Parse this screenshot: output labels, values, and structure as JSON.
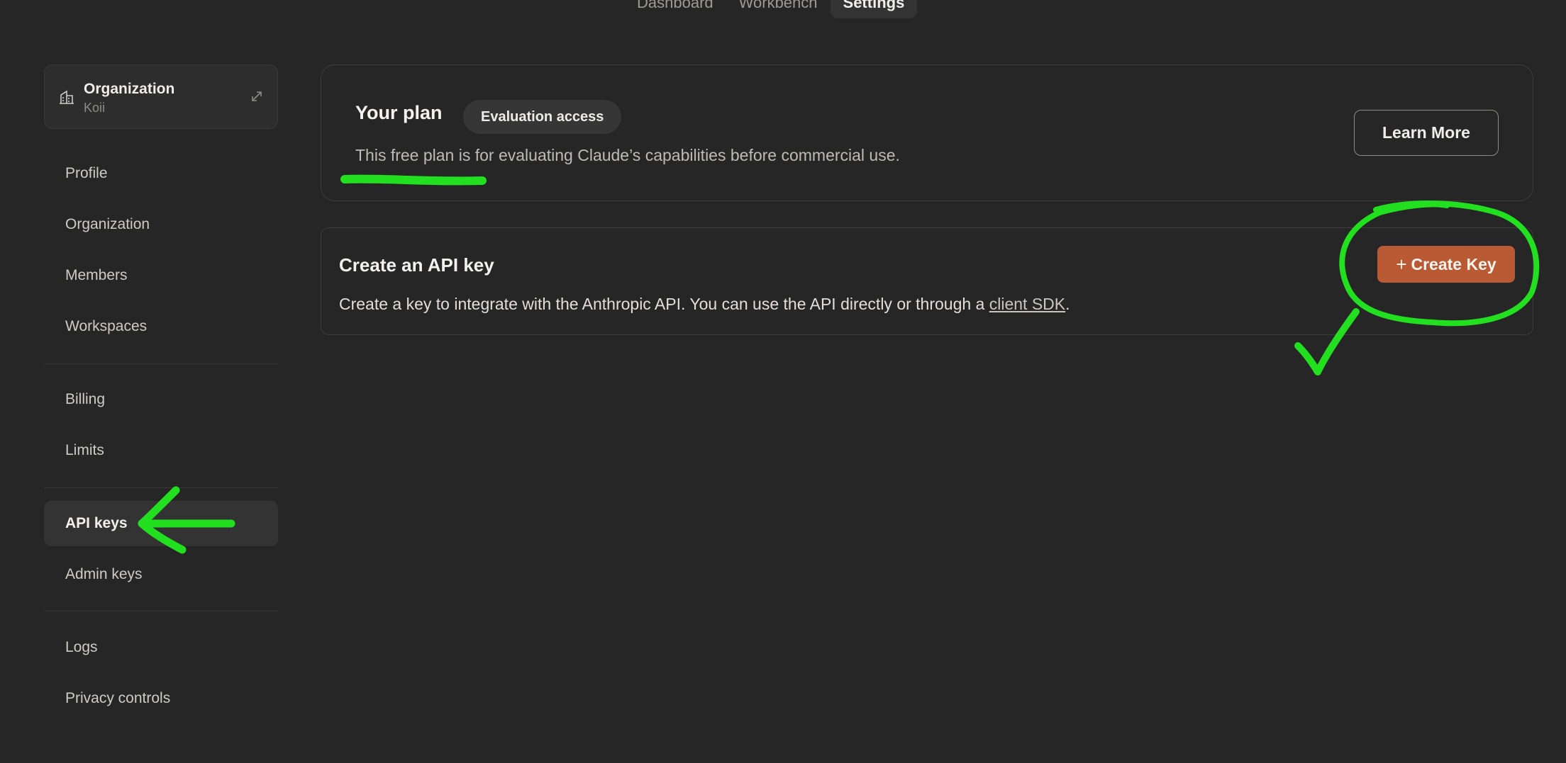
{
  "topnav": {
    "tabs": [
      {
        "label": "Dashboard"
      },
      {
        "label": "Workbench"
      },
      {
        "label": "Settings"
      }
    ]
  },
  "org": {
    "title": "Organization",
    "name": "Koii"
  },
  "sidebar": {
    "items": [
      {
        "label": "Profile"
      },
      {
        "label": "Organization"
      },
      {
        "label": "Members"
      },
      {
        "label": "Workspaces"
      },
      {
        "label": "Billing"
      },
      {
        "label": "Limits"
      },
      {
        "label": "API keys"
      },
      {
        "label": "Admin keys"
      },
      {
        "label": "Logs"
      },
      {
        "label": "Privacy controls"
      }
    ],
    "active": "API keys"
  },
  "plan": {
    "title": "Your plan",
    "badge": "Evaluation access",
    "description": "This free plan is for evaluating Claude’s capabilities before commercial use.",
    "learn_more": "Learn More"
  },
  "api": {
    "title": "Create an API key",
    "description_before": "Create a key to integrate with the Anthropic API. You can use the API directly or through a ",
    "link": "client SDK",
    "description_after": ".",
    "create_label": "Create Key"
  },
  "colors": {
    "background": "#262626",
    "accent": "#b95a34",
    "annotation": "#22e01f"
  }
}
